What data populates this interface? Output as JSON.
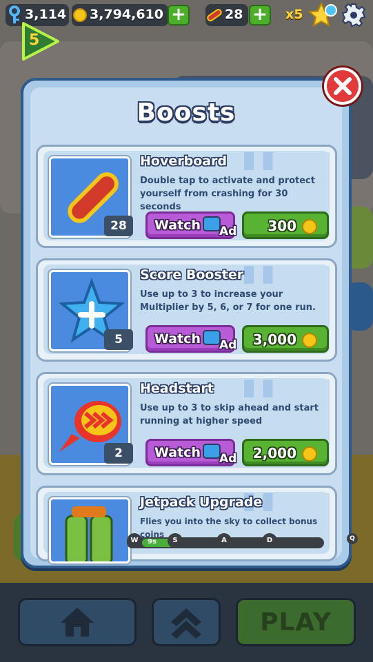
{
  "hud": {
    "keys": "3,114",
    "coins": "3,794,610",
    "hoverboards": "28",
    "multiplier": "x5",
    "level": "5"
  },
  "icons": [
    "key-icon",
    "coin-icon",
    "plus-icon",
    "hoverboard-icon",
    "star-icon",
    "gear-icon",
    "close-icon",
    "home-icon",
    "chevrons-up-icon",
    "tv-icon"
  ],
  "panel": {
    "title": "Boosts"
  },
  "boosts": [
    {
      "title": "Hoverboard",
      "description": "Double tap to activate and protect yourself from crashing for 30 seconds",
      "count": "28",
      "watch": "Watch",
      "ad": "Ad",
      "price": "300"
    },
    {
      "title": "Score Booster",
      "description": "Use up to 3 to increase your Multiplier by 5, 6, or 7 for one run.",
      "count": "5",
      "watch": "Watch",
      "ad": "Ad",
      "price": "3,000"
    },
    {
      "title": "Headstart",
      "description": "Use up to 3 to skip ahead and start running at higher speed",
      "count": "2",
      "watch": "Watch",
      "ad": "Ad",
      "price": "2,000"
    },
    {
      "title": "Jetpack Upgrade",
      "description": "Flies you into the sky to collect bonus coins"
    }
  ],
  "progress": {
    "time": "9s",
    "nodes": [
      "W",
      "S",
      "A",
      "D"
    ],
    "extra": "Q",
    "fill_fraction": 0.16
  },
  "bottom": {
    "play": "PLAY"
  },
  "colors": {
    "panel": "#a9cbe8",
    "watch": "#b85bd6",
    "price": "#58b332",
    "close": "#e23a3a"
  }
}
